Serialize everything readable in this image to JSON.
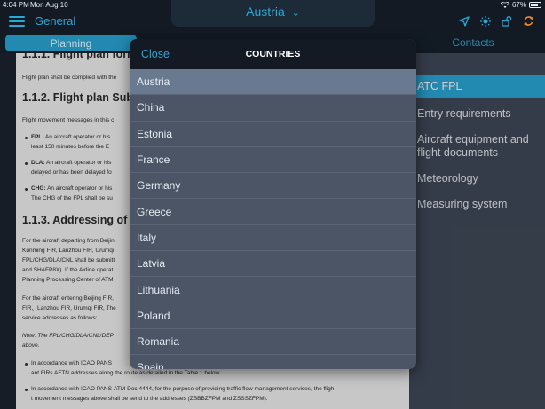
{
  "status_bar": {
    "time": "4:04 PM",
    "date": "Mon Aug 10",
    "battery": "67%"
  },
  "nav": {
    "section_title": "General",
    "country": "Austria"
  },
  "tabs": {
    "planning": "Planning",
    "contacts": "Contacts"
  },
  "document": {
    "top_heading": "1.1.1. Flight plan form",
    "p1": "Flight plan shall be complied with the",
    "h2": "1.1.2. Flight plan Subm",
    "p2": "Flight movement messages in this c",
    "fpl_label": "FPL:",
    "fpl_text": "An aircraft operator or his",
    "fpl_text2": "least 150 minutes before the E",
    "dla_label": "DLA:",
    "dla_text": "An aircraft operator or his",
    "dla_text2": "delayed or has been delayed fo",
    "chg_label": "CHG:",
    "chg_text": "An aircraft operator or his",
    "chg_text2": "The CHG of the FPL shall be su",
    "h3": "1.1.3. Addressing of fli",
    "p3a": "For the aircraft departing from Beijin",
    "p3b": "Kunming FIR, Lanzhou FIR, Urumqi",
    "p3c": "FPL/CHG/DLA/CNL shall be submitt",
    "p3d": "and SHAFP8X). If the Airline operat",
    "p3e": "Planning Processing Center of ATM",
    "p4a": "For the aircraft entering Beijing FIR,",
    "p4b": "FIR、Lanzhou FIR, Urumqi FIR, The",
    "p4c": "service addresses as follows:",
    "note1": "Note: The FPL/CHG/DLA/CNL/DEP",
    "note2": "above.",
    "b1a": "In accordance with ICAO PANS",
    "b1b": "ant FIRs AFTN addresses along the route as detailed in the Table 1 below.",
    "b2a": "In accordance with ICAO PANS-ATM Doc 4444, for the purpose of providing traffic flow management services, the fligh",
    "b2b": "t movement messages above shall be send to the addresses (ZBBBZFPM and ZSSSZFPM)."
  },
  "right_menu": [
    {
      "label": "ATC FPL",
      "active": true
    },
    {
      "label": "Entry requirements",
      "active": false
    },
    {
      "label": "Aircraft equipment and flight documents",
      "active": false
    },
    {
      "label": "Meteorology",
      "active": false
    },
    {
      "label": "Measuring system",
      "active": false
    }
  ],
  "popup": {
    "close": "Close",
    "title": "COUNTRIES",
    "countries": [
      "Austria",
      "China",
      "Estonia",
      "France",
      "Germany",
      "Greece",
      "Italy",
      "Latvia",
      "Lithuania",
      "Poland",
      "Romania",
      "Spain"
    ],
    "selected": "Austria"
  },
  "colors": {
    "accent": "#2aa8d8",
    "nav_bg": "#131a23",
    "popup_bg": "#4b5566",
    "selected_row": "#697a90"
  },
  "icons": [
    "menu-icon",
    "chevron-down-icon",
    "location-arrow-icon",
    "brightness-icon",
    "lock-open-icon",
    "sync-icon",
    "wifi-icon",
    "battery-icon"
  ]
}
